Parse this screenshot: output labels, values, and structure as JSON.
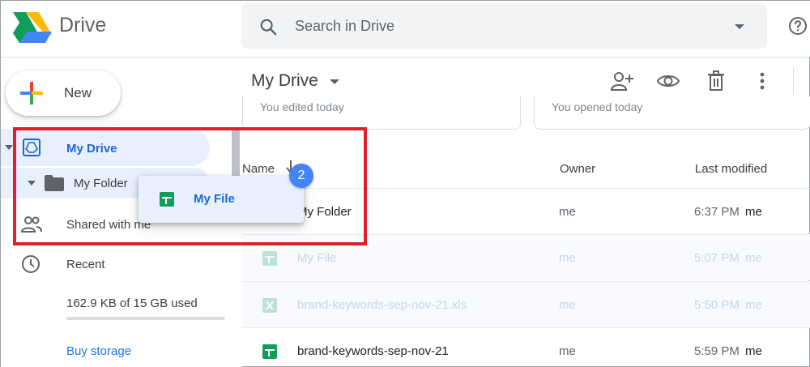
{
  "header": {
    "brand": "Drive",
    "search_placeholder": "Search in Drive"
  },
  "sidebar": {
    "new_label": "New",
    "items": [
      {
        "label": "My Drive"
      },
      {
        "label": "My Folder"
      },
      {
        "label": "Shared with me"
      },
      {
        "label": "Recent"
      }
    ],
    "storage_text": "162.9 KB of 15 GB used",
    "storage_used_fraction": 0.0,
    "buy_storage": "Buy storage"
  },
  "main": {
    "title": "My Drive",
    "cards": [
      {
        "label": "You edited today"
      },
      {
        "label": "You opened today"
      }
    ],
    "columns": {
      "name": "Name",
      "owner": "Owner",
      "last_modified": "Last modified"
    },
    "rows": [
      {
        "name": "My Folder",
        "type": "folder",
        "owner": "me",
        "modified": "6:37 PM",
        "modified_by": "me"
      },
      {
        "name": "My File",
        "type": "sheets",
        "owner": "me",
        "modified": "5:07 PM",
        "modified_by": "me"
      },
      {
        "name": "brand-keywords-sep-nov-21.xls",
        "type": "excel",
        "owner": "me",
        "modified": "5:50 PM",
        "modified_by": "me"
      },
      {
        "name": "brand-keywords-sep-nov-21",
        "type": "sheets",
        "owner": "me",
        "modified": "5:59 PM",
        "modified_by": "me"
      }
    ]
  },
  "drag": {
    "label": "My File",
    "count": "2"
  },
  "colors": {
    "accent_blue": "#1a73e8",
    "selected_bg": "#e8f0fe",
    "highlight_red": "#e0202a",
    "sheets_green": "#0f9d58"
  }
}
